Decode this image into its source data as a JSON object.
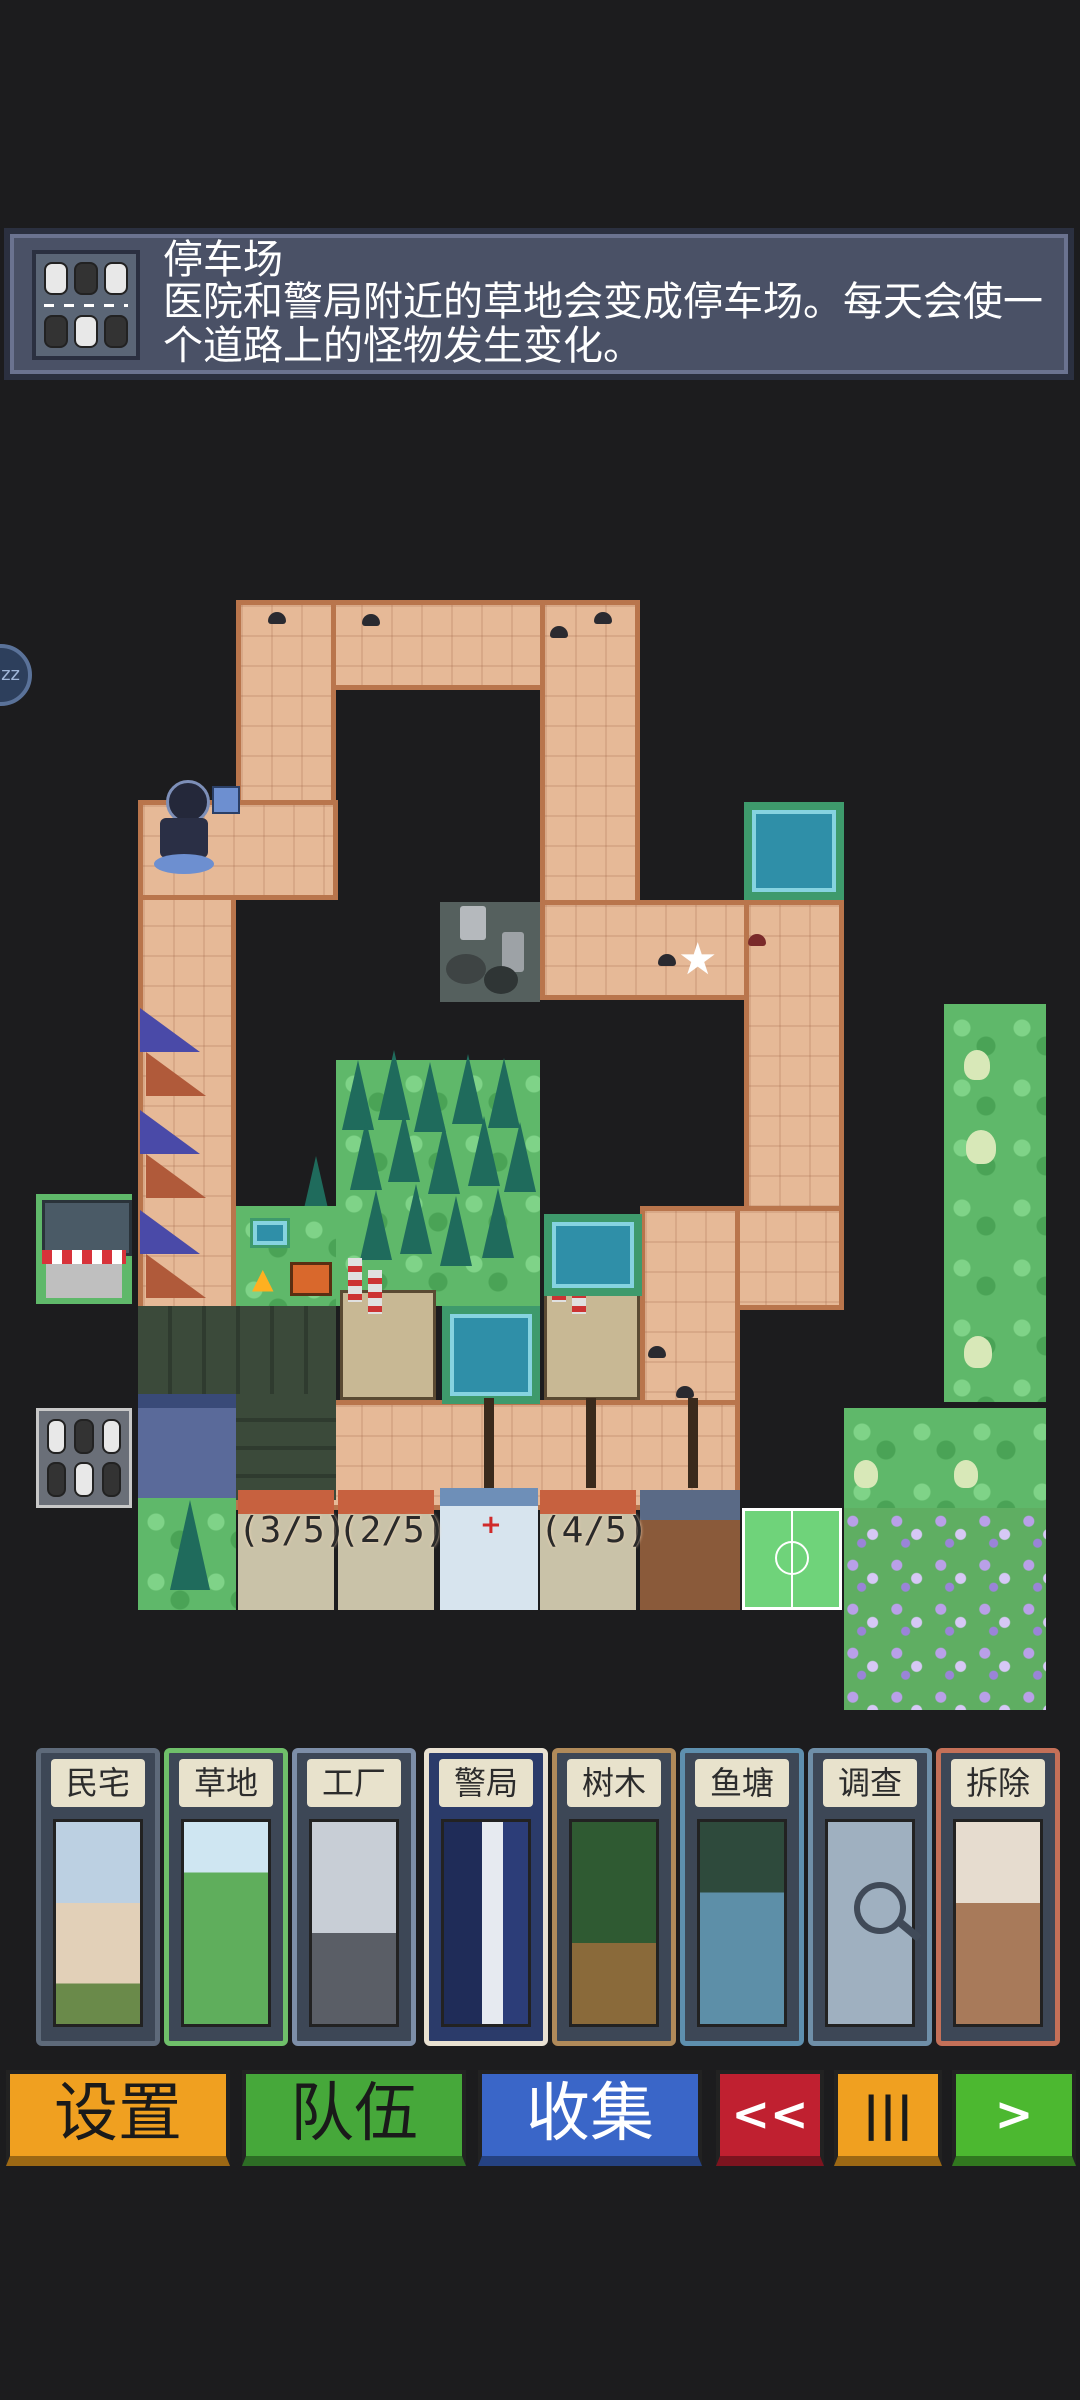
{
  "info_panel": {
    "title": "停车场",
    "description": "医院和警局附近的草地会变成停车场。每天会使一个道路上的怪物发生变化。",
    "icon": "parking-lot-icon"
  },
  "sleep_button": {
    "label": "zz"
  },
  "map": {
    "house_counters": [
      "(3/5)",
      "(2/5)",
      "(4/5)"
    ]
  },
  "cards": [
    {
      "label": "民宅",
      "border_color": "#c98a66",
      "art_color": "#a7b7c8"
    },
    {
      "label": "草地",
      "border_color": "#6fbf6a",
      "art_color": "#5fae5c"
    },
    {
      "label": "工厂",
      "border_color": "#7d8ea8",
      "art_color": "#8c8f96"
    },
    {
      "label": "警局",
      "border_color": "#e9e1d2",
      "art_color": "#24336a"
    },
    {
      "label": "树木",
      "border_color": "#b08a5a",
      "art_color": "#3f6b3c"
    },
    {
      "label": "鱼塘",
      "border_color": "#5e8fae",
      "art_color": "#3e6f7a"
    },
    {
      "label": "调查",
      "border_color": "#6f8fa8",
      "art_color": "#9fb0c0"
    },
    {
      "label": "拆除",
      "border_color": "#c47058",
      "art_color": "#c9a890"
    }
  ],
  "bottom_bar": {
    "settings": "设置",
    "team": "队伍",
    "collection": "收集",
    "rewind": "<<",
    "pause": "|||",
    "play": ">"
  },
  "colors": {
    "settings": "#f0a020",
    "team": "#46a83a",
    "collection": "#3a66c8",
    "rewind": "#c02030",
    "pause": "#f0a020",
    "play": "#4cb830"
  }
}
